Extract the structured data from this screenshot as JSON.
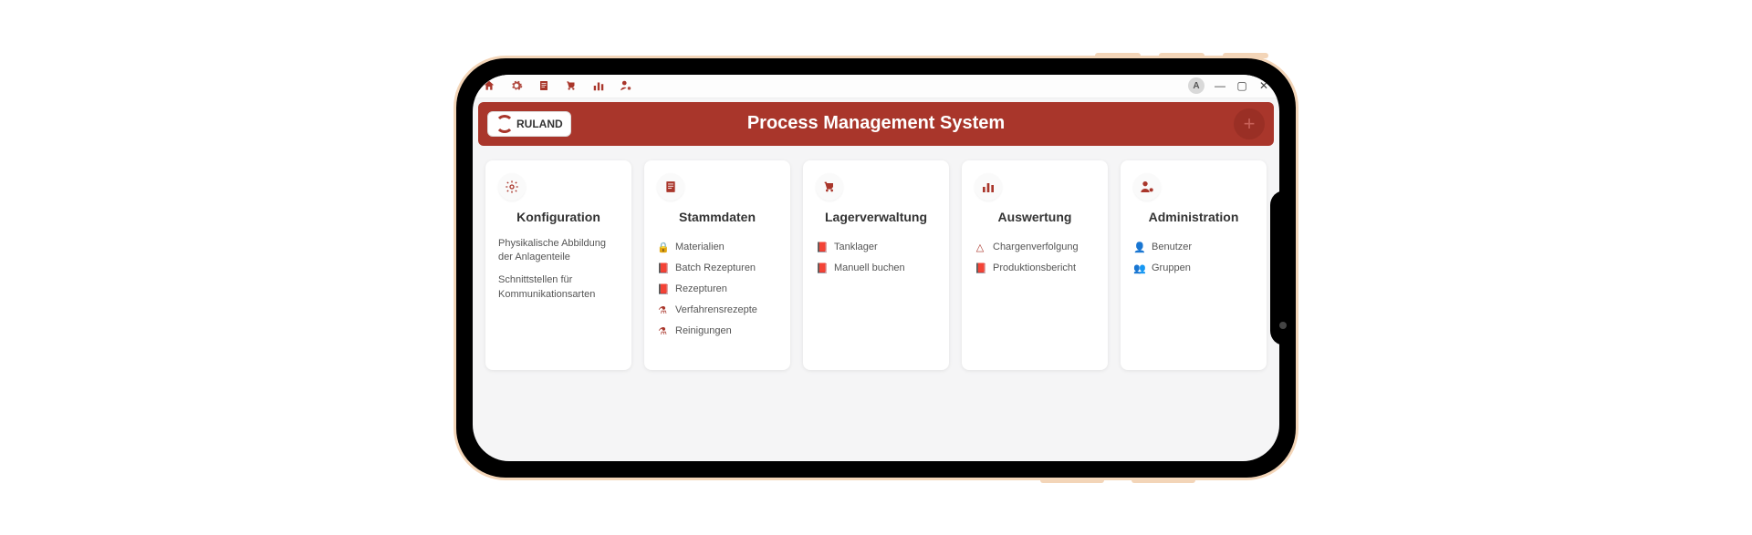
{
  "toolbar": {
    "avatar_letter": "A"
  },
  "header": {
    "logo_text": "RULAND",
    "title": "Process Management System"
  },
  "cards": [
    {
      "id": "konfiguration",
      "title": "Konfiguration",
      "descriptions": [
        "Physikalische Abbildung der Anlagenteile",
        "Schnittstellen für Kommunikationsarten"
      ],
      "items": []
    },
    {
      "id": "stammdaten",
      "title": "Stammdaten",
      "descriptions": [],
      "items": [
        {
          "icon": "lock",
          "label": "Materialien"
        },
        {
          "icon": "doc",
          "label": "Batch Rezepturen"
        },
        {
          "icon": "doc",
          "label": "Rezepturen"
        },
        {
          "icon": "flask",
          "label": "Verfahrensrezepte"
        },
        {
          "icon": "flask",
          "label": "Reinigungen"
        }
      ]
    },
    {
      "id": "lagerverwaltung",
      "title": "Lagerverwaltung",
      "descriptions": [],
      "items": [
        {
          "icon": "doc",
          "label": "Tanklager"
        },
        {
          "icon": "doc",
          "label": "Manuell buchen"
        }
      ]
    },
    {
      "id": "auswertung",
      "title": "Auswertung",
      "descriptions": [],
      "items": [
        {
          "icon": "warn",
          "label": "Chargenverfolgung"
        },
        {
          "icon": "doc",
          "label": "Produktionsbericht"
        }
      ]
    },
    {
      "id": "administration",
      "title": "Administration",
      "descriptions": [],
      "items": [
        {
          "icon": "user",
          "label": "Benutzer"
        },
        {
          "icon": "users",
          "label": "Gruppen"
        }
      ]
    }
  ]
}
